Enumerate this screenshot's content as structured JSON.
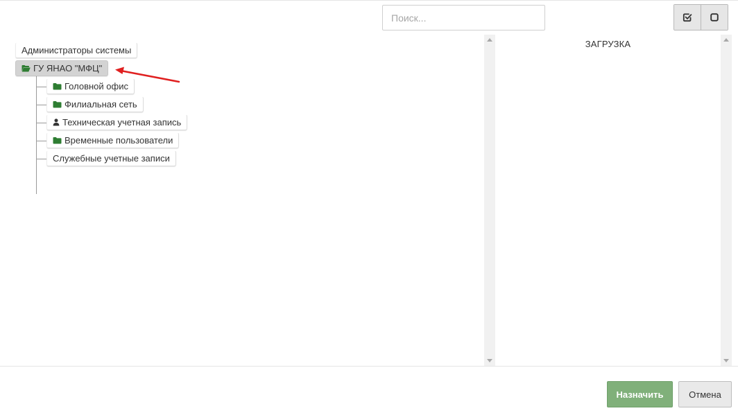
{
  "search": {
    "placeholder": "Поиск..."
  },
  "toolbar": {
    "select_all_icon": "checkbox-checked-icon",
    "deselect_all_icon": "checkbox-empty-icon"
  },
  "tree": {
    "root_items": [
      {
        "label": "Администраторы системы",
        "icon": ""
      },
      {
        "label": "ГУ ЯНАО \"МФЦ\"",
        "icon": "folder-open-icon",
        "selected": true
      }
    ],
    "children": [
      {
        "label": "Головной офис",
        "icon": "folder-icon"
      },
      {
        "label": "Филиальная сеть",
        "icon": "folder-icon"
      },
      {
        "label": "Техническая учетная запись",
        "icon": "user-icon"
      },
      {
        "label": "Временные пользователи",
        "icon": "folder-icon"
      },
      {
        "label": "Служебные учетные записи",
        "icon": ""
      }
    ]
  },
  "right_panel": {
    "status_text": "ЗАГРУЗКА"
  },
  "footer": {
    "assign_label": "Назначить",
    "cancel_label": "Отмена"
  },
  "colors": {
    "folder_green": "#2e7d32",
    "assign_button": "#80b07a",
    "annotation_arrow": "#e02020"
  }
}
